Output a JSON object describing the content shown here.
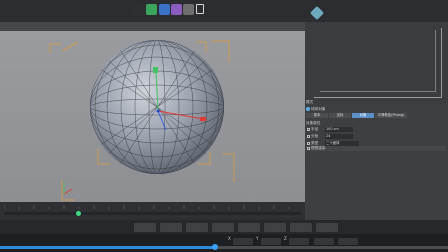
{
  "toolbar": {
    "buttons": [
      {
        "icon": "mode-icon",
        "color": "#2e2f31"
      },
      {
        "icon": "record-icon",
        "color": "#3aa55d"
      },
      {
        "icon": "tool-icon",
        "color": "#3a72c8"
      },
      {
        "icon": "deformer-icon",
        "color": "#8a5cc0"
      },
      {
        "icon": "scene-icon",
        "color": "#6e6e6e"
      },
      {
        "icon": "lock-icon",
        "color": "#ffffff"
      }
    ]
  },
  "timeline": {
    "playhead_fraction": 0.25
  },
  "playback": {
    "progress_fraction": 0.48
  },
  "attributes": {
    "mode_label": "模式",
    "object_label": "球体对象",
    "tabs": [
      "基本",
      "坐标",
      "对象",
      "平滑着色(Phong)"
    ],
    "active_tab": 2,
    "section_label": "对象属性",
    "properties": [
      {
        "label": "半径",
        "value": "100 cm"
      },
      {
        "label": "分段",
        "value": "24"
      },
      {
        "label": "类型",
        "value": "二十面体"
      }
    ],
    "render_label": "理想渲染"
  },
  "coordinates": {
    "labels": [
      "X",
      "Y",
      "Z"
    ],
    "values": [
      "0 cm",
      "0 cm",
      "0 cm"
    ]
  },
  "colors": {
    "accent": "#2e8bd8",
    "axis_x": "#e53935",
    "axis_y": "#43c463",
    "axis_z": "#3a5fe0",
    "camera_bracket": "#e09b3d"
  }
}
